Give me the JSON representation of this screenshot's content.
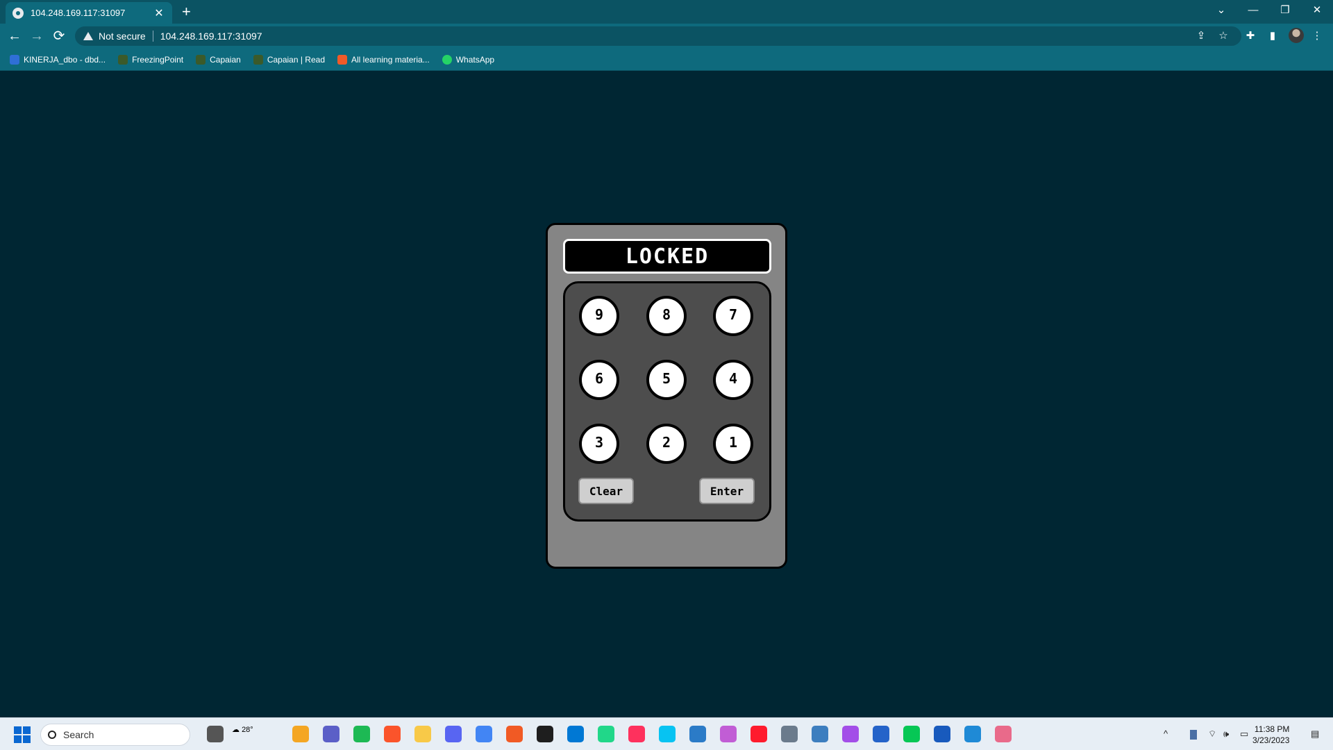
{
  "browser": {
    "tab_title": "104.248.169.117:31097",
    "tab_close": "✕",
    "new_tab": "+",
    "security_label": "Not secure",
    "url": "104.248.169.117:31097",
    "nav": {
      "back": "←",
      "forward": "→",
      "reload": "⟳"
    },
    "window": {
      "tab_list": "⌄",
      "minimize": "—",
      "restore": "❐",
      "close": "✕"
    },
    "toolbar_icons": {
      "share": "⇪",
      "star": "☆",
      "extensions": "✚",
      "sidepanel": "▮",
      "menu": "⋮"
    }
  },
  "bookmarks": [
    {
      "label": "KINERJA_dbo - dbd...",
      "color": "#2f6fd6"
    },
    {
      "label": "FreezingPoint",
      "color": "#3b5a2a"
    },
    {
      "label": "Capaian",
      "color": "#3b5a2a"
    },
    {
      "label": "Capaian | Read",
      "color": "#3b5a2a"
    },
    {
      "label": "All learning materia...",
      "color": "#f05a28"
    },
    {
      "label": "WhatsApp",
      "color": "#25d366"
    }
  ],
  "lock": {
    "display_text": "LOCKED",
    "keys": [
      "9",
      "8",
      "7",
      "6",
      "5",
      "4",
      "3",
      "2",
      "1"
    ],
    "clear_label": "Clear",
    "enter_label": "Enter"
  },
  "taskbar": {
    "search_placeholder": "Search",
    "weather_temp": "28°",
    "time": "11:38 PM",
    "date": "3/23/2023",
    "app_colors": [
      "#f4a623",
      "#5b5fc7",
      "#1db954",
      "#fb542b",
      "#f8c948",
      "#5865f2",
      "#4285f4",
      "#f15a24",
      "#1e1e1e",
      "#0078d4",
      "#21d789",
      "#fe315d",
      "#07c3f2",
      "#2b7bc7",
      "#c15dd5",
      "#ff1b2d",
      "#6b7b8c",
      "#3d7ebf",
      "#a34ee8",
      "#2463c9",
      "#06c755",
      "#185abd",
      "#1f8ad6",
      "#e96a8a"
    ]
  }
}
